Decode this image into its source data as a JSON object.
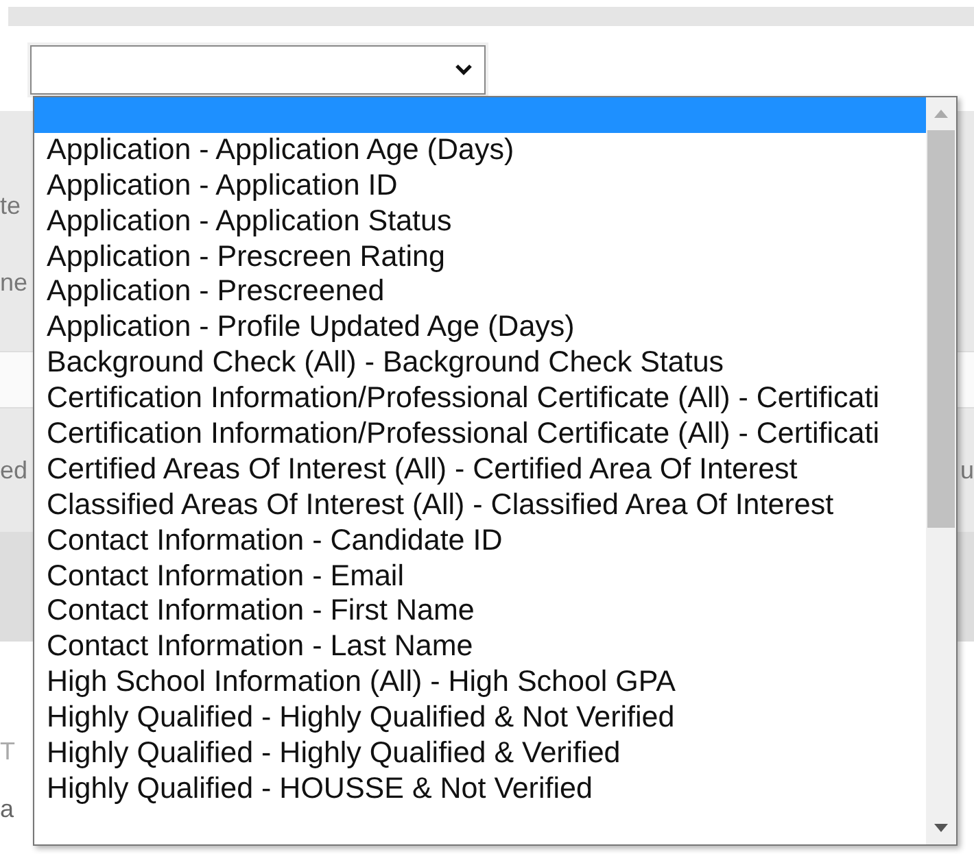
{
  "background": {
    "fragments": [
      {
        "kind": "label",
        "text": "te"
      },
      {
        "kind": "label",
        "text": "ne"
      },
      {
        "kind": "label",
        "text": "ed"
      },
      {
        "kind": "right",
        "text": "u"
      },
      {
        "kind": "heading",
        "text": "T"
      },
      {
        "kind": "note",
        "text": "a"
      }
    ]
  },
  "select": {
    "expanded": true
  },
  "options": [
    {
      "kind": "blank",
      "selected": true
    },
    {
      "kind": "option",
      "label": "Application - Application Age (Days)",
      "selected": false
    },
    {
      "kind": "option",
      "label": "Application - Application ID",
      "selected": false
    },
    {
      "kind": "option",
      "label": "Application - Application Status",
      "selected": false
    },
    {
      "kind": "option",
      "label": "Application - Prescreen Rating",
      "selected": false
    },
    {
      "kind": "option",
      "label": "Application - Prescreened",
      "selected": false
    },
    {
      "kind": "option",
      "label": "Application - Profile Updated Age (Days)",
      "selected": false
    },
    {
      "kind": "option",
      "label": "Background Check (All) - Background Check Status",
      "selected": false
    },
    {
      "kind": "option",
      "label": "Certification Information/Professional Certificate (All) - Certificati",
      "selected": false
    },
    {
      "kind": "option",
      "label": "Certification Information/Professional Certificate (All) - Certificati",
      "selected": false
    },
    {
      "kind": "option",
      "label": "Certified Areas Of Interest (All) - Certified Area Of Interest",
      "selected": false
    },
    {
      "kind": "option",
      "label": "Classified Areas Of Interest (All) - Classified Area Of Interest",
      "selected": false
    },
    {
      "kind": "option",
      "label": "Contact Information - Candidate ID",
      "selected": false
    },
    {
      "kind": "option",
      "label": "Contact Information - Email",
      "selected": false
    },
    {
      "kind": "option",
      "label": "Contact Information - First Name",
      "selected": false
    },
    {
      "kind": "option",
      "label": "Contact Information - Last Name",
      "selected": false
    },
    {
      "kind": "option",
      "label": "High School Information (All) - High School GPA",
      "selected": false
    },
    {
      "kind": "option",
      "label": "Highly Qualified - Highly Qualified & Not Verified",
      "selected": false
    },
    {
      "kind": "option",
      "label": "Highly Qualified - Highly Qualified & Verified",
      "selected": false
    },
    {
      "kind": "option",
      "label": "Highly Qualified - HOUSSE & Not Verified",
      "selected": false
    }
  ]
}
